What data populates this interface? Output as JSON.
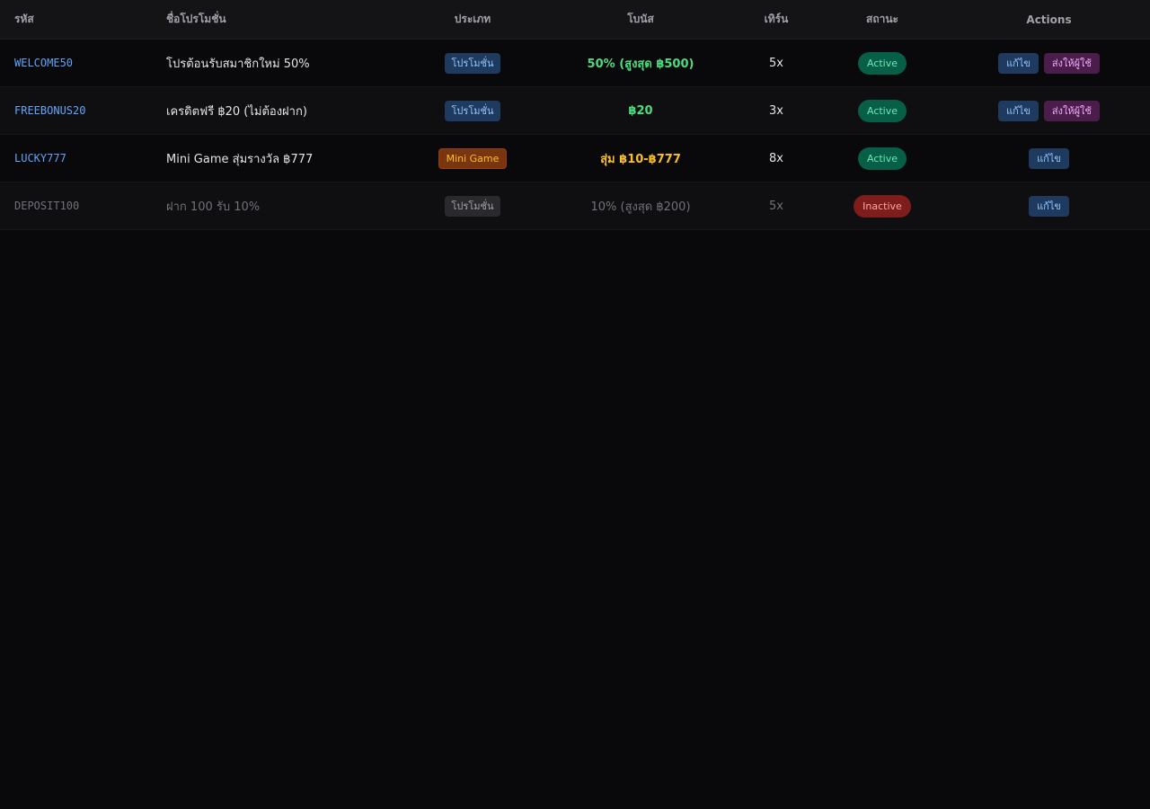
{
  "columns": {
    "code": "รหัส",
    "name": "ชื่อโปรโมชั่น",
    "type": "ประเภท",
    "bonus": "โบนัส",
    "turnover": "เทิร์น",
    "status": "สถานะ",
    "actions": "Actions"
  },
  "rows": [
    {
      "code": "WELCOME50",
      "name": "โปรต้อนรับสมาชิกใหม่ 50%",
      "type": "โปรโมชั่น",
      "bonus": "50% (สูงสุด ฿500)",
      "turnover": "5x",
      "status": "Active",
      "edit_label": "แก้ไข",
      "send_label": "ส่งให้ผู้ใช้"
    },
    {
      "code": "FREEBONUS20",
      "name": "เครดิตฟรี ฿20 (ไม่ต้องฝาก)",
      "type": "โปรโมชั่น",
      "bonus": "฿20",
      "turnover": "3x",
      "status": "Active",
      "edit_label": "แก้ไข",
      "send_label": "ส่งให้ผู้ใช้"
    },
    {
      "code": "LUCKY777",
      "name": "Mini Game สุ่มรางวัล ฿777",
      "type": "Mini Game",
      "bonus": "สุ่ม ฿10-฿777",
      "turnover": "8x",
      "status": "Active",
      "edit_label": "แก้ไข"
    },
    {
      "code": "DEPOSIT100",
      "name": "ฝาก 100 รับ 10%",
      "type": "โปรโมชั่น",
      "bonus": "10% (สูงสุด ฿200)",
      "turnover": "5x",
      "status": "Inactive",
      "edit_label": "แก้ไข"
    }
  ]
}
